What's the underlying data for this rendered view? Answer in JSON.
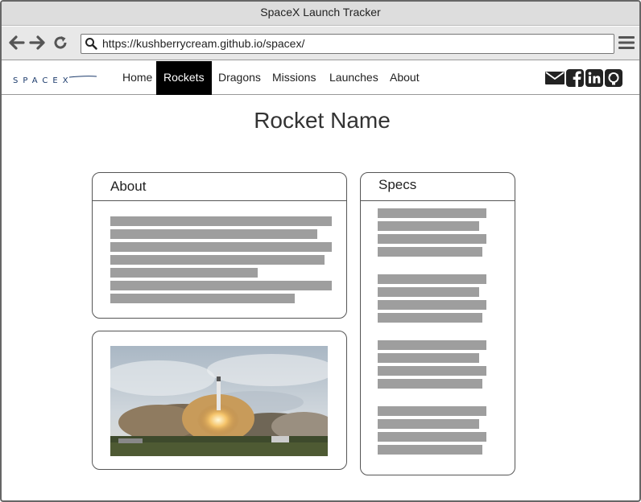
{
  "window": {
    "title": "SpaceX Launch Tracker"
  },
  "browser": {
    "url": "https://kushberrycream.github.io/spacex/",
    "icons": [
      "back-arrow-icon",
      "forward-arrow-icon",
      "reload-icon",
      "search-icon",
      "hamburger-menu-icon"
    ]
  },
  "site": {
    "logo_text": "SPACEX",
    "nav": [
      {
        "label": "Home"
      },
      {
        "label": "Rockets",
        "active": true
      },
      {
        "label": "Dragons"
      },
      {
        "label": "Missions"
      },
      {
        "label": "Launches"
      },
      {
        "label": "About"
      }
    ],
    "social_icons": [
      "email-icon",
      "facebook-icon",
      "linkedin-icon",
      "github-icon"
    ]
  },
  "main": {
    "title": "Rocket Name",
    "about_panel": {
      "heading": "About"
    },
    "specs_panel": {
      "heading": "Specs"
    },
    "image_panel": {
      "image": "rocket-launch-photo"
    }
  },
  "colors": {
    "active_nav_bg": "#000000",
    "placeholder_bar": "#9e9e9e",
    "titlebar": "#dddddd"
  }
}
